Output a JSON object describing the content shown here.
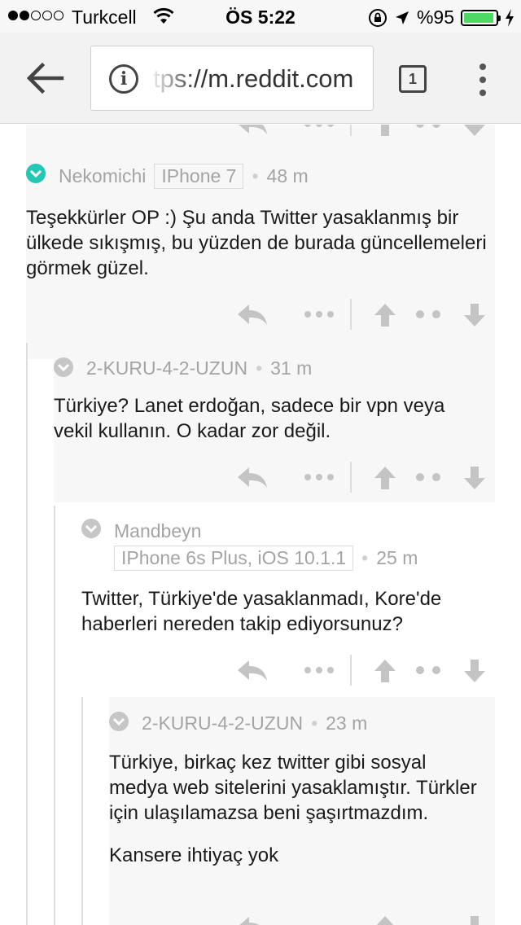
{
  "status_bar": {
    "carrier": "Turkcell",
    "time": "ÖS 5:22",
    "battery_percent": "%95",
    "signal_bars": 2
  },
  "browser": {
    "url": "tps://m.reddit.com",
    "tab_count": "1"
  },
  "comments": [
    {
      "author": "Nekomichi",
      "flair": "IPhone 7",
      "time": "48 m",
      "body": [
        "Teşekkürler OP :) Şu anda Twitter yasaklanmış bir ülkede sıkışmış, bu yüzden de burada güncellemeleri görmek güzel."
      ]
    },
    {
      "author": "2-KURU-4-2-UZUN",
      "flair": "",
      "time": "31 m",
      "body": [
        "Türkiye? Lanet erdoğan, sadece bir vpn veya vekil kullanın. O kadar zor değil."
      ]
    },
    {
      "author": "Mandbeyn",
      "flair": "IPhone 6s Plus, iOS 10.1.1",
      "time": "25 m",
      "body": [
        "Twitter, Türkiye'de yasaklanmadı, Kore'de haberleri nereden takip ediyorsunuz?"
      ]
    },
    {
      "author": "2-KURU-4-2-UZUN",
      "flair": "",
      "time": "23 m",
      "body": [
        "Türkiye, birkaç kez twitter gibi sosyal medya web sitelerini yasaklamıştır. Türkler için ulaşılamazsa beni şaşırtmazdım.",
        "Kansere ihtiyaç yok"
      ]
    }
  ],
  "icons": {
    "reply": "reply-arrow-icon",
    "more": "more-dots-icon",
    "upvote": "upvote-arrow-icon",
    "downvote": "downvote-arrow-icon",
    "collapse": "collapse-chevron-icon"
  },
  "colors": {
    "accent_teal": "#24c6b4",
    "meta_grey": "#a5a4a4",
    "icon_grey": "#c4c4c4",
    "battery_green": "#4cd964"
  }
}
